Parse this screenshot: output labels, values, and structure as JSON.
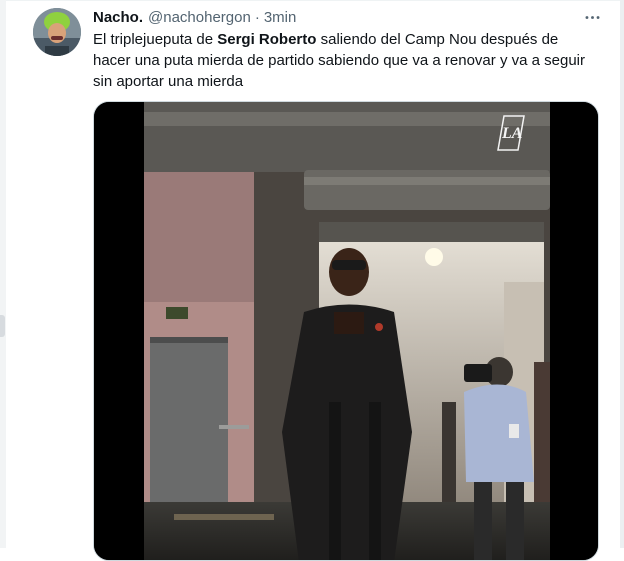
{
  "tweet": {
    "display_name": "Nacho.",
    "handle": "@nachohergon",
    "separator": "·",
    "time": "3min",
    "text_pre": "El triplejueputa de ",
    "text_bold": "Sergi Roberto",
    "text_post": " saliendo del Camp Nou después de hacer una puta mierda de partido sabiendo que va a renovar y va a seguir sin aportar una mierda"
  },
  "media": {
    "logo_text": "LA"
  },
  "icons": [
    "avatar",
    "more-icon"
  ],
  "colors": {
    "text_primary": "#0f1419",
    "text_secondary": "#536471",
    "border": "#cfd9de"
  }
}
